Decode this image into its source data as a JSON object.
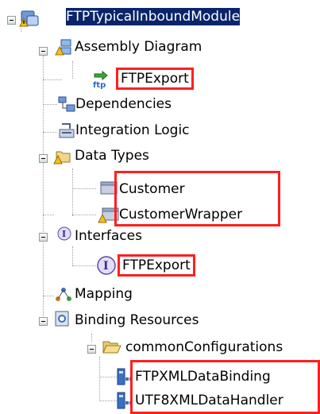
{
  "tree": {
    "root": {
      "label": "FTPTypicalInboundModule",
      "icon": "module-warning-icon"
    },
    "assembly": {
      "label": "Assembly Diagram",
      "icon": "assembly-diagram-warning-icon"
    },
    "assembly_child": {
      "label": "FTPExport",
      "icon": "ftp-export-icon"
    },
    "dependencies": {
      "label": "Dependencies",
      "icon": "dependencies-icon"
    },
    "integration": {
      "label": "Integration Logic",
      "icon": "integration-logic-icon"
    },
    "datatypes": {
      "label": "Data Types",
      "icon": "data-types-warning-icon"
    },
    "customer": {
      "label": "Customer",
      "icon": "business-object-icon"
    },
    "customer_wrapper": {
      "label": "CustomerWrapper",
      "icon": "business-object-warning-icon"
    },
    "interfaces": {
      "label": "Interfaces",
      "icon": "interfaces-icon"
    },
    "interfaces_child": {
      "label": "FTPExport",
      "icon": "interface-icon"
    },
    "mapping": {
      "label": "Mapping",
      "icon": "mapping-icon"
    },
    "binding": {
      "label": "Binding Resources",
      "icon": "binding-resources-icon"
    },
    "common": {
      "label": "commonConfigurations",
      "icon": "folder-open-icon"
    },
    "ftpxml": {
      "label": "FTPXMLDataBinding",
      "icon": "data-binding-icon"
    },
    "utf8": {
      "label": "UTF8XMLDataHandler",
      "icon": "data-handler-icon"
    }
  },
  "colors": {
    "highlight": "#ff1f1f",
    "selection": "#0a246a"
  }
}
